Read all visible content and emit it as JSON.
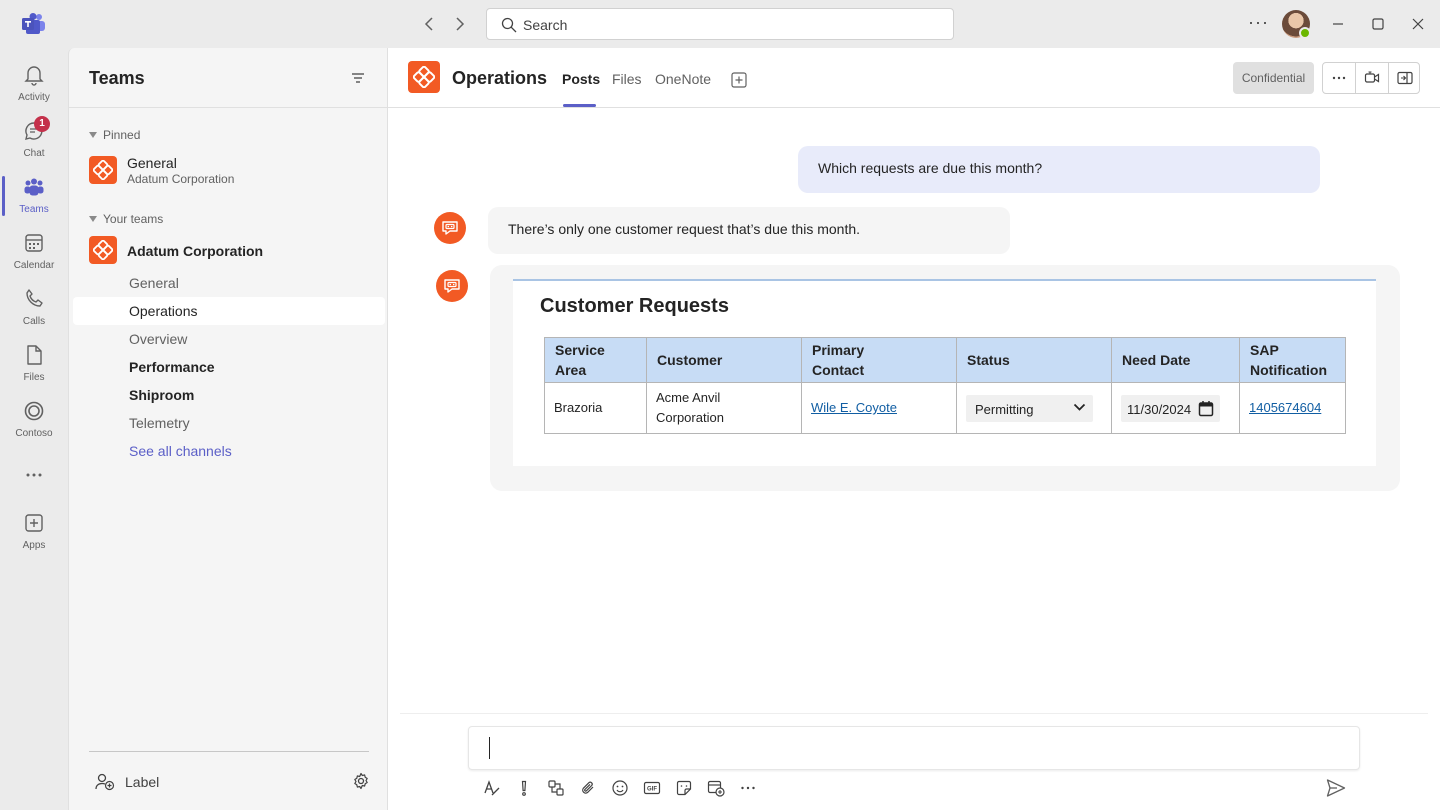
{
  "titlebar": {
    "search_placeholder": "Search"
  },
  "rail": {
    "items": [
      {
        "label": "Activity",
        "icon": "bell-icon"
      },
      {
        "label": "Chat",
        "icon": "chat-icon",
        "badge": "1"
      },
      {
        "label": "Teams",
        "icon": "teams-icon",
        "active": true
      },
      {
        "label": "Calendar",
        "icon": "calendar-icon"
      },
      {
        "label": "Calls",
        "icon": "phone-icon"
      },
      {
        "label": "Files",
        "icon": "file-icon"
      },
      {
        "label": "Contoso",
        "icon": "contoso-icon"
      },
      {
        "label": "Apps",
        "icon": "add-app-icon"
      }
    ]
  },
  "left_panel": {
    "title": "Teams",
    "pinned_section": "Pinned",
    "pinned_item": {
      "name": "General",
      "sub": "Adatum Corporation"
    },
    "your_teams_section": "Your teams",
    "team_name": "Adatum Corporation",
    "channels": [
      "General",
      "Operations",
      "Overview",
      "Performance",
      "Shiproom",
      "Telemetry",
      "See all channels"
    ],
    "bottom_label": "Label"
  },
  "channel_header": {
    "title": "Operations",
    "tabs": [
      "Posts",
      "Files",
      "OneNote"
    ],
    "confidential": "Confidential"
  },
  "conversation": {
    "user_message": "Which requests are due this month?",
    "bot_message": "There’s only one customer request that’s due this month."
  },
  "card": {
    "title": "Customer Requests",
    "headers": [
      "Service Area",
      "Customer",
      "Primary Contact",
      "Status",
      "Need Date",
      "SAP Notification"
    ],
    "row": {
      "service_area": "Brazoria",
      "customer": "Acme Anvil Corporation",
      "contact": "Wile E. Coyote",
      "status": "Permitting",
      "need_date": "11/30/2024",
      "sap": "1405674604"
    }
  },
  "colors": {
    "accent": "#5b5fc7",
    "team_brand": "#f25a24",
    "table_header": "#c7dcf5",
    "link": "#115ea3"
  }
}
